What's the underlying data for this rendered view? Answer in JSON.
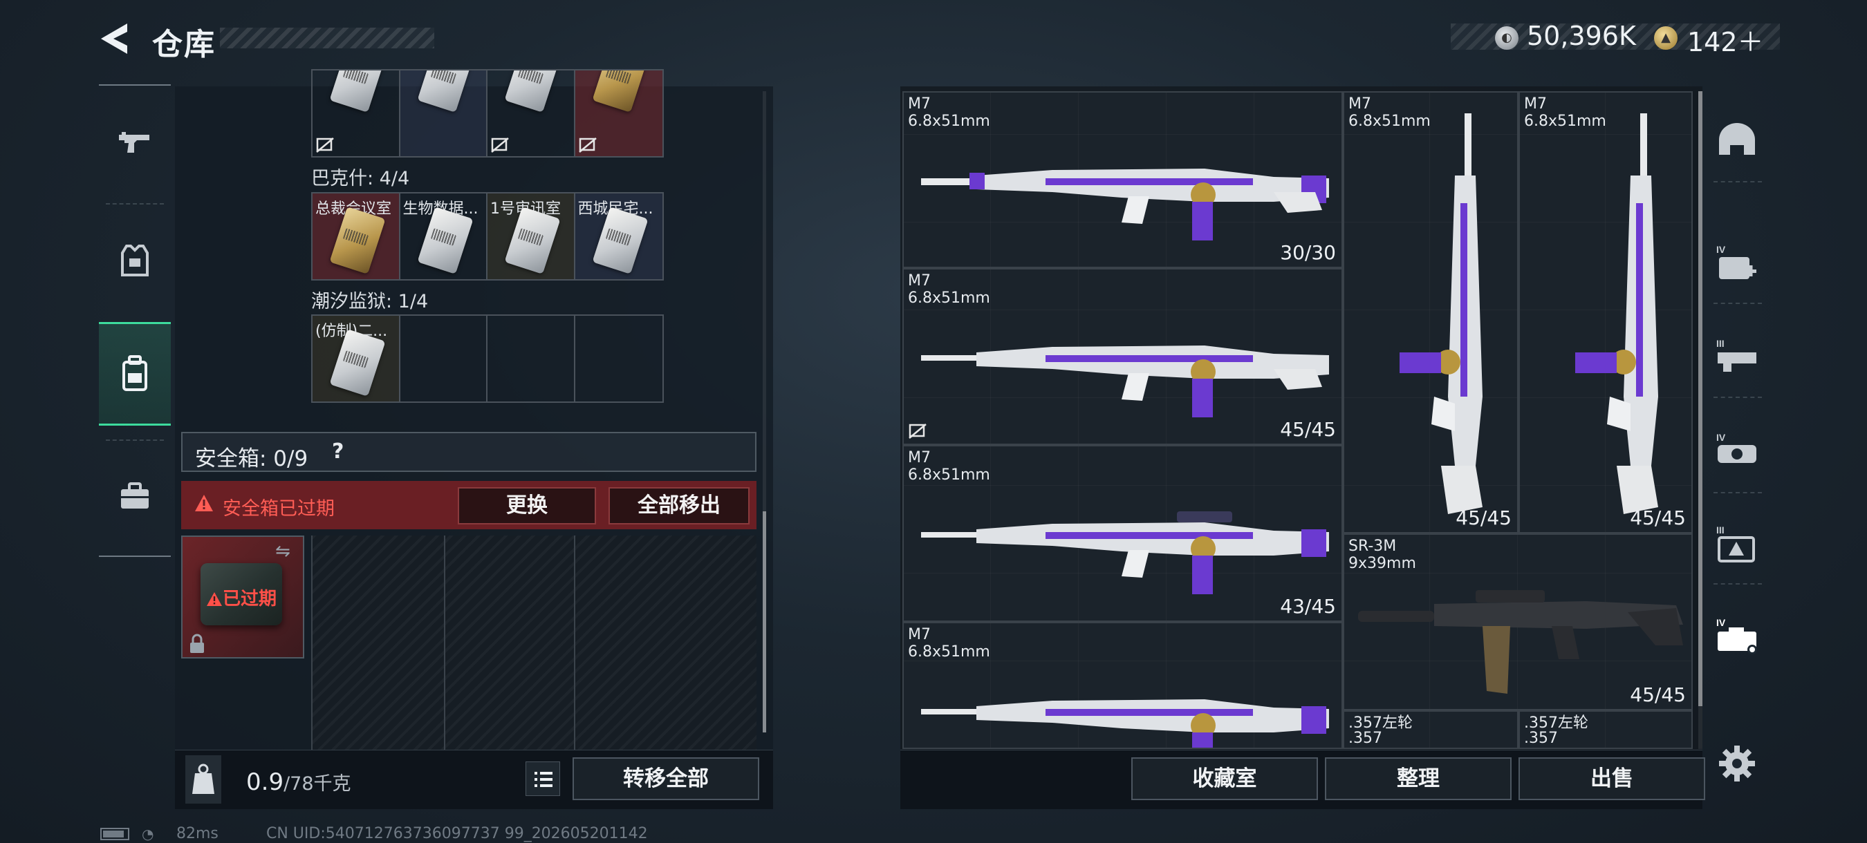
{
  "header": {
    "title": "仓库",
    "currencies": [
      {
        "icon": "silver-coin-icon",
        "value": "50,396K"
      },
      {
        "icon": "gold-coin-icon",
        "value": "142＋"
      }
    ]
  },
  "left_nav": {
    "items": [
      {
        "icon": "pistol-icon",
        "active": false
      },
      {
        "icon": "armor-vest-icon",
        "active": false
      },
      {
        "icon": "backpack-icon",
        "active": true
      },
      {
        "icon": "briefcase-icon",
        "active": false
      }
    ]
  },
  "backpack": {
    "top_row": [
      {
        "label": "",
        "gold": false,
        "no_trade": true
      },
      {
        "label": "",
        "gold": false,
        "no_trade": false
      },
      {
        "label": "",
        "gold": false,
        "no_trade": true
      },
      {
        "label": "",
        "gold": true,
        "no_trade": true
      }
    ],
    "groups": [
      {
        "label": "巴克什: 4/4",
        "cards": [
          {
            "label": "总裁会议室",
            "gold": true
          },
          {
            "label": "生物数据...",
            "gold": false
          },
          {
            "label": "1号审讯室",
            "gold": false
          },
          {
            "label": "西城民宅...",
            "gold": false
          }
        ]
      },
      {
        "label": "潮汐监狱: 1/4",
        "cards": [
          {
            "label": "(仿制)二...",
            "gold": false
          }
        ]
      }
    ],
    "safebox": {
      "label": "安全箱: 0/9",
      "help": "?",
      "warning": "安全箱已过期",
      "replace_button": "更换",
      "remove_all_button": "全部移出",
      "item_status": "已过期"
    },
    "footer": {
      "weight": "0.9",
      "capacity": "/78千克",
      "transfer_all_button": "转移全部"
    }
  },
  "warehouse": {
    "items": [
      {
        "name": "M7",
        "caliber": "6.8x51mm",
        "ammo": "30/30",
        "no_trade": false
      },
      {
        "name": "M7",
        "caliber": "6.8x51mm",
        "ammo": "45/45",
        "no_trade": false
      },
      {
        "name": "M7",
        "caliber": "6.8x51mm",
        "ammo": "45/45",
        "no_trade": false
      },
      {
        "name": "M7",
        "caliber": "6.8x51mm",
        "ammo": "45/45",
        "no_trade": true
      },
      {
        "name": "M7",
        "caliber": "6.8x51mm",
        "ammo": "43/45",
        "no_trade": false
      },
      {
        "name": "SR-3M",
        "caliber": "9x39mm",
        "ammo": "45/45",
        "no_trade": false
      },
      {
        "name": "M7",
        "caliber": "6.8x51mm",
        "ammo": "",
        "no_trade": false
      },
      {
        "name": ".357左轮",
        "caliber": ".357",
        "ammo": "",
        "no_trade": false
      },
      {
        "name": ".357左轮",
        "caliber": ".357",
        "ammo": "",
        "no_trade": false
      }
    ],
    "categories": [
      {
        "icon": "helmet-icon",
        "tier": ""
      },
      {
        "icon": "medkit-icon",
        "tier": "IV"
      },
      {
        "icon": "weapon-parts-icon",
        "tier": "III"
      },
      {
        "icon": "scope-icon",
        "tier": "IV"
      },
      {
        "icon": "keycard-icon",
        "tier": "III"
      },
      {
        "icon": "container-icon",
        "tier": "IV"
      }
    ],
    "footer": {
      "collection_button": "收藏室",
      "organize_button": "整理",
      "sell_button": "出售"
    }
  },
  "status": {
    "ping": "82ms",
    "uid": "CN UID:540712763736097737 99_202605201142"
  },
  "colors": {
    "accent_green": "#3ddc9d",
    "warning_red": "#ff5d55",
    "expired_bar": "#6a1f24",
    "weapon_purple": "#7a3fd0"
  }
}
